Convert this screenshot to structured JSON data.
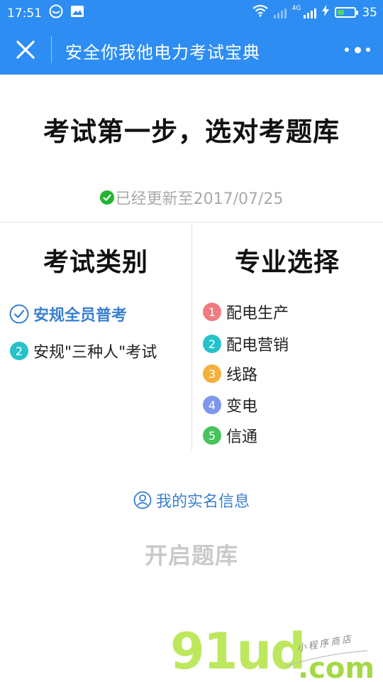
{
  "statusbar": {
    "time": "17:51",
    "network_label": "4G",
    "battery_level": "35",
    "battery_fraction": 0.35
  },
  "navbar": {
    "title": "安全你我他电力考试宝典"
  },
  "headline": "考试第一步，选对考题库",
  "updated_text": "已经更新至2017/07/25",
  "exam_category": {
    "title": "考试类别",
    "items": [
      {
        "label": "安规全员普考",
        "selected": true,
        "color": "#3a7fd1"
      },
      {
        "number": "2",
        "label": "安规\"三种人\"考试",
        "selected": false,
        "color": "#26c2c9"
      }
    ]
  },
  "specialty": {
    "title": "专业选择",
    "items": [
      {
        "number": "1",
        "label": "配电生产",
        "color": "#f07a82"
      },
      {
        "number": "2",
        "label": "配电营销",
        "color": "#26c2c9"
      },
      {
        "number": "3",
        "label": "线路",
        "color": "#f3b13b"
      },
      {
        "number": "4",
        "label": "变电",
        "color": "#7f97ea"
      },
      {
        "number": "5",
        "label": "信通",
        "color": "#46c45c"
      }
    ]
  },
  "realname_link": "我的实名信息",
  "start_button": "开启题库",
  "watermark": {
    "brand": "91ud",
    "suffix": ".com",
    "tagline": "小程序商店"
  },
  "colors": {
    "primary": "#2d8df2",
    "link": "#3a7fd1",
    "check_green": "#21b530",
    "disabled": "#c9c9c9"
  }
}
